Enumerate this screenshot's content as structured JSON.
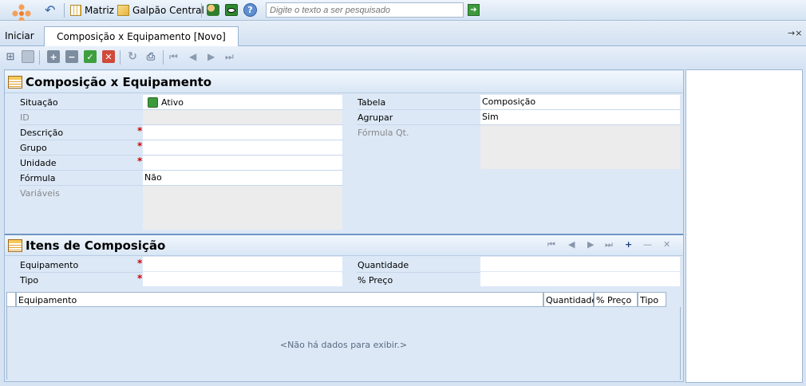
{
  "topbar": {
    "company": "Matriz",
    "branch": "Galpão Central",
    "search_placeholder": "Digite o texto a ser pesquisado"
  },
  "tabs": {
    "start": "Iniciar",
    "document": "Composição x Equipamento [Novo]",
    "pin": "→×"
  },
  "section1": {
    "title": "Composição x Equipamento",
    "left": [
      {
        "label": "Situação",
        "value": "Ativo",
        "required": false,
        "disabled": false
      },
      {
        "label": "ID",
        "value": "",
        "required": false,
        "disabled": true
      },
      {
        "label": "Descrição",
        "value": "",
        "required": true,
        "disabled": false
      },
      {
        "label": "Grupo",
        "value": "",
        "required": true,
        "disabled": false
      },
      {
        "label": "Unidade",
        "value": "",
        "required": true,
        "disabled": false
      },
      {
        "label": "Fórmula",
        "value": "Não",
        "required": false,
        "disabled": false
      },
      {
        "label": "Variáveis",
        "value": "",
        "required": false,
        "disabled": true
      }
    ],
    "right": [
      {
        "label": "Tabela",
        "value": "Composição"
      },
      {
        "label": "Agrupar",
        "value": "Sim"
      },
      {
        "label": "Fórmula Qt.",
        "value": ""
      }
    ]
  },
  "section2": {
    "title": "Itens de Composição",
    "fields": {
      "equipamento": "Equipamento",
      "tipo": "Tipo",
      "quantidade": "Quantidade",
      "preco": "% Preço"
    },
    "grid_columns": [
      "Equipamento",
      "Quantidade",
      "% Preço",
      "Tipo"
    ],
    "empty_text": "<Não há dados para exibir.>"
  },
  "colors": {
    "accent": "#dce8f6",
    "required": "#d00000",
    "status_active": "#3c9a3c"
  }
}
